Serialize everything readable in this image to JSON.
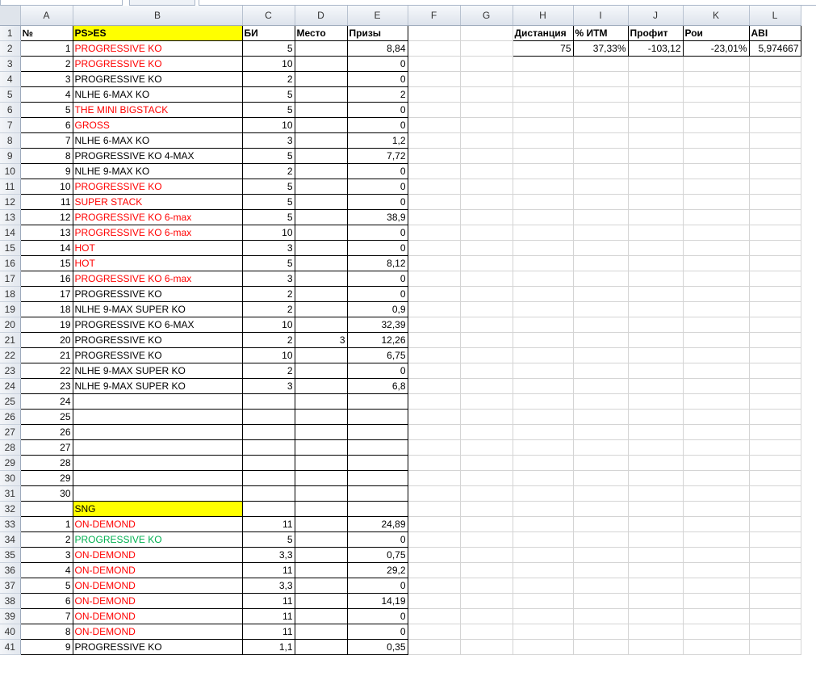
{
  "columns": [
    "A",
    "B",
    "C",
    "D",
    "E",
    "F",
    "G",
    "H",
    "I",
    "J",
    "K",
    "L"
  ],
  "rows": [
    {
      "n": "1",
      "cells": [
        {
          "v": "№",
          "s": "hdr"
        },
        {
          "v": "PS>ES",
          "s": "hdr yellow"
        },
        {
          "v": "БИ",
          "s": "hdr"
        },
        {
          "v": "Место",
          "s": "hdr"
        },
        {
          "v": "Призы",
          "s": "hdr"
        },
        {
          "v": ""
        },
        {
          "v": ""
        },
        {
          "v": "Дистанция",
          "s": "hdr"
        },
        {
          "v": "% ИТМ",
          "s": "hdr"
        },
        {
          "v": "Профит",
          "s": "hdr"
        },
        {
          "v": "Рои",
          "s": "hdr"
        },
        {
          "v": "ABI",
          "s": "hdr"
        }
      ]
    },
    {
      "n": "2",
      "cells": [
        {
          "v": "1"
        },
        {
          "v": "PROGRESSIVE KO",
          "c": "red"
        },
        {
          "v": "5"
        },
        {
          "v": ""
        },
        {
          "v": "8,84"
        },
        {
          "v": ""
        },
        {
          "v": ""
        },
        {
          "v": "75"
        },
        {
          "v": "37,33%"
        },
        {
          "v": "-103,12"
        },
        {
          "v": "-23,01%"
        },
        {
          "v": "5,974667"
        }
      ]
    },
    {
      "n": "3",
      "cells": [
        {
          "v": "2"
        },
        {
          "v": "PROGRESSIVE KO",
          "c": "red"
        },
        {
          "v": "10"
        },
        {
          "v": ""
        },
        {
          "v": "0"
        }
      ]
    },
    {
      "n": "4",
      "cells": [
        {
          "v": "3"
        },
        {
          "v": "PROGRESSIVE KO"
        },
        {
          "v": "2"
        },
        {
          "v": ""
        },
        {
          "v": "0"
        }
      ]
    },
    {
      "n": "5",
      "cells": [
        {
          "v": "4"
        },
        {
          "v": "NLHE 6-MAX KO"
        },
        {
          "v": "5"
        },
        {
          "v": ""
        },
        {
          "v": "2"
        }
      ]
    },
    {
      "n": "6",
      "cells": [
        {
          "v": "5"
        },
        {
          "v": "THE MINI BIGSTACK",
          "c": "red"
        },
        {
          "v": "5"
        },
        {
          "v": ""
        },
        {
          "v": "0"
        }
      ]
    },
    {
      "n": "7",
      "cells": [
        {
          "v": "6"
        },
        {
          "v": "GROSS",
          "c": "red"
        },
        {
          "v": "10"
        },
        {
          "v": ""
        },
        {
          "v": "0"
        }
      ]
    },
    {
      "n": "8",
      "cells": [
        {
          "v": "7"
        },
        {
          "v": "NLHE 6-MAX KO"
        },
        {
          "v": "3"
        },
        {
          "v": ""
        },
        {
          "v": "1,2"
        }
      ]
    },
    {
      "n": "9",
      "cells": [
        {
          "v": "8"
        },
        {
          "v": "PROGRESSIVE KO 4-MAX"
        },
        {
          "v": "5"
        },
        {
          "v": ""
        },
        {
          "v": "7,72"
        }
      ]
    },
    {
      "n": "10",
      "cells": [
        {
          "v": "9"
        },
        {
          "v": "NLHE 9-MAX KO"
        },
        {
          "v": "2"
        },
        {
          "v": ""
        },
        {
          "v": "0"
        }
      ]
    },
    {
      "n": "11",
      "cells": [
        {
          "v": "10"
        },
        {
          "v": "PROGRESSIVE KO",
          "c": "red"
        },
        {
          "v": "5"
        },
        {
          "v": ""
        },
        {
          "v": "0"
        }
      ]
    },
    {
      "n": "12",
      "cells": [
        {
          "v": "11"
        },
        {
          "v": "SUPER STACK",
          "c": "red"
        },
        {
          "v": "5"
        },
        {
          "v": ""
        },
        {
          "v": "0"
        }
      ]
    },
    {
      "n": "13",
      "cells": [
        {
          "v": "12"
        },
        {
          "v": "PROGRESSIVE KO 6-max",
          "c": "red"
        },
        {
          "v": "5"
        },
        {
          "v": ""
        },
        {
          "v": "38,9"
        }
      ]
    },
    {
      "n": "14",
      "cells": [
        {
          "v": "13"
        },
        {
          "v": "PROGRESSIVE KO 6-max",
          "c": "red"
        },
        {
          "v": "10"
        },
        {
          "v": ""
        },
        {
          "v": "0"
        }
      ]
    },
    {
      "n": "15",
      "cells": [
        {
          "v": "14"
        },
        {
          "v": "HOT",
          "c": "red"
        },
        {
          "v": "3"
        },
        {
          "v": ""
        },
        {
          "v": "0"
        }
      ]
    },
    {
      "n": "16",
      "cells": [
        {
          "v": "15"
        },
        {
          "v": "HOT",
          "c": "red"
        },
        {
          "v": "5"
        },
        {
          "v": ""
        },
        {
          "v": "8,12"
        }
      ]
    },
    {
      "n": "17",
      "cells": [
        {
          "v": "16"
        },
        {
          "v": "PROGRESSIVE KO 6-max",
          "c": "red"
        },
        {
          "v": "3"
        },
        {
          "v": ""
        },
        {
          "v": "0"
        }
      ]
    },
    {
      "n": "18",
      "cells": [
        {
          "v": "17"
        },
        {
          "v": "PROGRESSIVE KO"
        },
        {
          "v": "2"
        },
        {
          "v": ""
        },
        {
          "v": "0"
        }
      ]
    },
    {
      "n": "19",
      "cells": [
        {
          "v": "18"
        },
        {
          "v": "NLHE 9-MAX SUPER KO"
        },
        {
          "v": "2"
        },
        {
          "v": ""
        },
        {
          "v": "0,9"
        }
      ]
    },
    {
      "n": "20",
      "cells": [
        {
          "v": "19"
        },
        {
          "v": "PROGRESSIVE KO 6-MAX"
        },
        {
          "v": "10"
        },
        {
          "v": ""
        },
        {
          "v": "32,39"
        }
      ]
    },
    {
      "n": "21",
      "cells": [
        {
          "v": "20"
        },
        {
          "v": "PROGRESSIVE KO"
        },
        {
          "v": "2"
        },
        {
          "v": "3"
        },
        {
          "v": "12,26"
        }
      ]
    },
    {
      "n": "22",
      "cells": [
        {
          "v": "21"
        },
        {
          "v": "PROGRESSIVE KO"
        },
        {
          "v": "10"
        },
        {
          "v": ""
        },
        {
          "v": "6,75"
        }
      ]
    },
    {
      "n": "23",
      "cells": [
        {
          "v": "22"
        },
        {
          "v": "NLHE 9-MAX SUPER KO"
        },
        {
          "v": "2"
        },
        {
          "v": ""
        },
        {
          "v": "0"
        }
      ]
    },
    {
      "n": "24",
      "cells": [
        {
          "v": "23"
        },
        {
          "v": "NLHE 9-MAX SUPER KO"
        },
        {
          "v": "3"
        },
        {
          "v": ""
        },
        {
          "v": "6,8"
        }
      ]
    },
    {
      "n": "25",
      "cells": [
        {
          "v": "24"
        },
        {
          "v": ""
        },
        {
          "v": ""
        },
        {
          "v": ""
        },
        {
          "v": ""
        }
      ]
    },
    {
      "n": "26",
      "cells": [
        {
          "v": "25"
        },
        {
          "v": ""
        },
        {
          "v": ""
        },
        {
          "v": ""
        },
        {
          "v": ""
        }
      ]
    },
    {
      "n": "27",
      "cells": [
        {
          "v": "26"
        },
        {
          "v": ""
        },
        {
          "v": ""
        },
        {
          "v": ""
        },
        {
          "v": ""
        }
      ]
    },
    {
      "n": "28",
      "cells": [
        {
          "v": "27"
        },
        {
          "v": ""
        },
        {
          "v": ""
        },
        {
          "v": ""
        },
        {
          "v": ""
        }
      ]
    },
    {
      "n": "29",
      "cells": [
        {
          "v": "28"
        },
        {
          "v": ""
        },
        {
          "v": ""
        },
        {
          "v": ""
        },
        {
          "v": ""
        }
      ]
    },
    {
      "n": "30",
      "cells": [
        {
          "v": "29"
        },
        {
          "v": ""
        },
        {
          "v": ""
        },
        {
          "v": ""
        },
        {
          "v": ""
        }
      ]
    },
    {
      "n": "31",
      "cells": [
        {
          "v": "30"
        },
        {
          "v": ""
        },
        {
          "v": ""
        },
        {
          "v": ""
        },
        {
          "v": ""
        }
      ]
    },
    {
      "n": "32",
      "cells": [
        {
          "v": ""
        },
        {
          "v": "SNG",
          "s": "yellow"
        },
        {
          "v": ""
        },
        {
          "v": ""
        },
        {
          "v": ""
        }
      ]
    },
    {
      "n": "33",
      "cells": [
        {
          "v": "1"
        },
        {
          "v": "ON-DEMOND",
          "c": "red"
        },
        {
          "v": "11"
        },
        {
          "v": ""
        },
        {
          "v": "24,89"
        }
      ]
    },
    {
      "n": "34",
      "cells": [
        {
          "v": "2"
        },
        {
          "v": "PROGRESSIVE KO",
          "c": "green"
        },
        {
          "v": "5"
        },
        {
          "v": ""
        },
        {
          "v": "0"
        }
      ]
    },
    {
      "n": "35",
      "cells": [
        {
          "v": "3"
        },
        {
          "v": "ON-DEMOND",
          "c": "red"
        },
        {
          "v": "3,3"
        },
        {
          "v": ""
        },
        {
          "v": "0,75"
        }
      ]
    },
    {
      "n": "36",
      "cells": [
        {
          "v": "4"
        },
        {
          "v": "ON-DEMOND",
          "c": "red"
        },
        {
          "v": "11"
        },
        {
          "v": ""
        },
        {
          "v": "29,2"
        }
      ]
    },
    {
      "n": "37",
      "cells": [
        {
          "v": "5"
        },
        {
          "v": "ON-DEMOND",
          "c": "red"
        },
        {
          "v": "3,3"
        },
        {
          "v": ""
        },
        {
          "v": "0"
        }
      ]
    },
    {
      "n": "38",
      "cells": [
        {
          "v": "6"
        },
        {
          "v": "ON-DEMOND",
          "c": "red"
        },
        {
          "v": "11"
        },
        {
          "v": ""
        },
        {
          "v": "14,19"
        }
      ]
    },
    {
      "n": "39",
      "cells": [
        {
          "v": "7"
        },
        {
          "v": "ON-DEMOND",
          "c": "red"
        },
        {
          "v": "11"
        },
        {
          "v": ""
        },
        {
          "v": "0"
        }
      ]
    },
    {
      "n": "40",
      "cells": [
        {
          "v": "8"
        },
        {
          "v": "ON-DEMOND",
          "c": "red"
        },
        {
          "v": "11"
        },
        {
          "v": ""
        },
        {
          "v": "0"
        }
      ]
    },
    {
      "n": "41",
      "cells": [
        {
          "v": "9"
        },
        {
          "v": "PROGRESSIVE KO"
        },
        {
          "v": "1,1"
        },
        {
          "v": ""
        },
        {
          "v": "0,35"
        }
      ]
    }
  ]
}
